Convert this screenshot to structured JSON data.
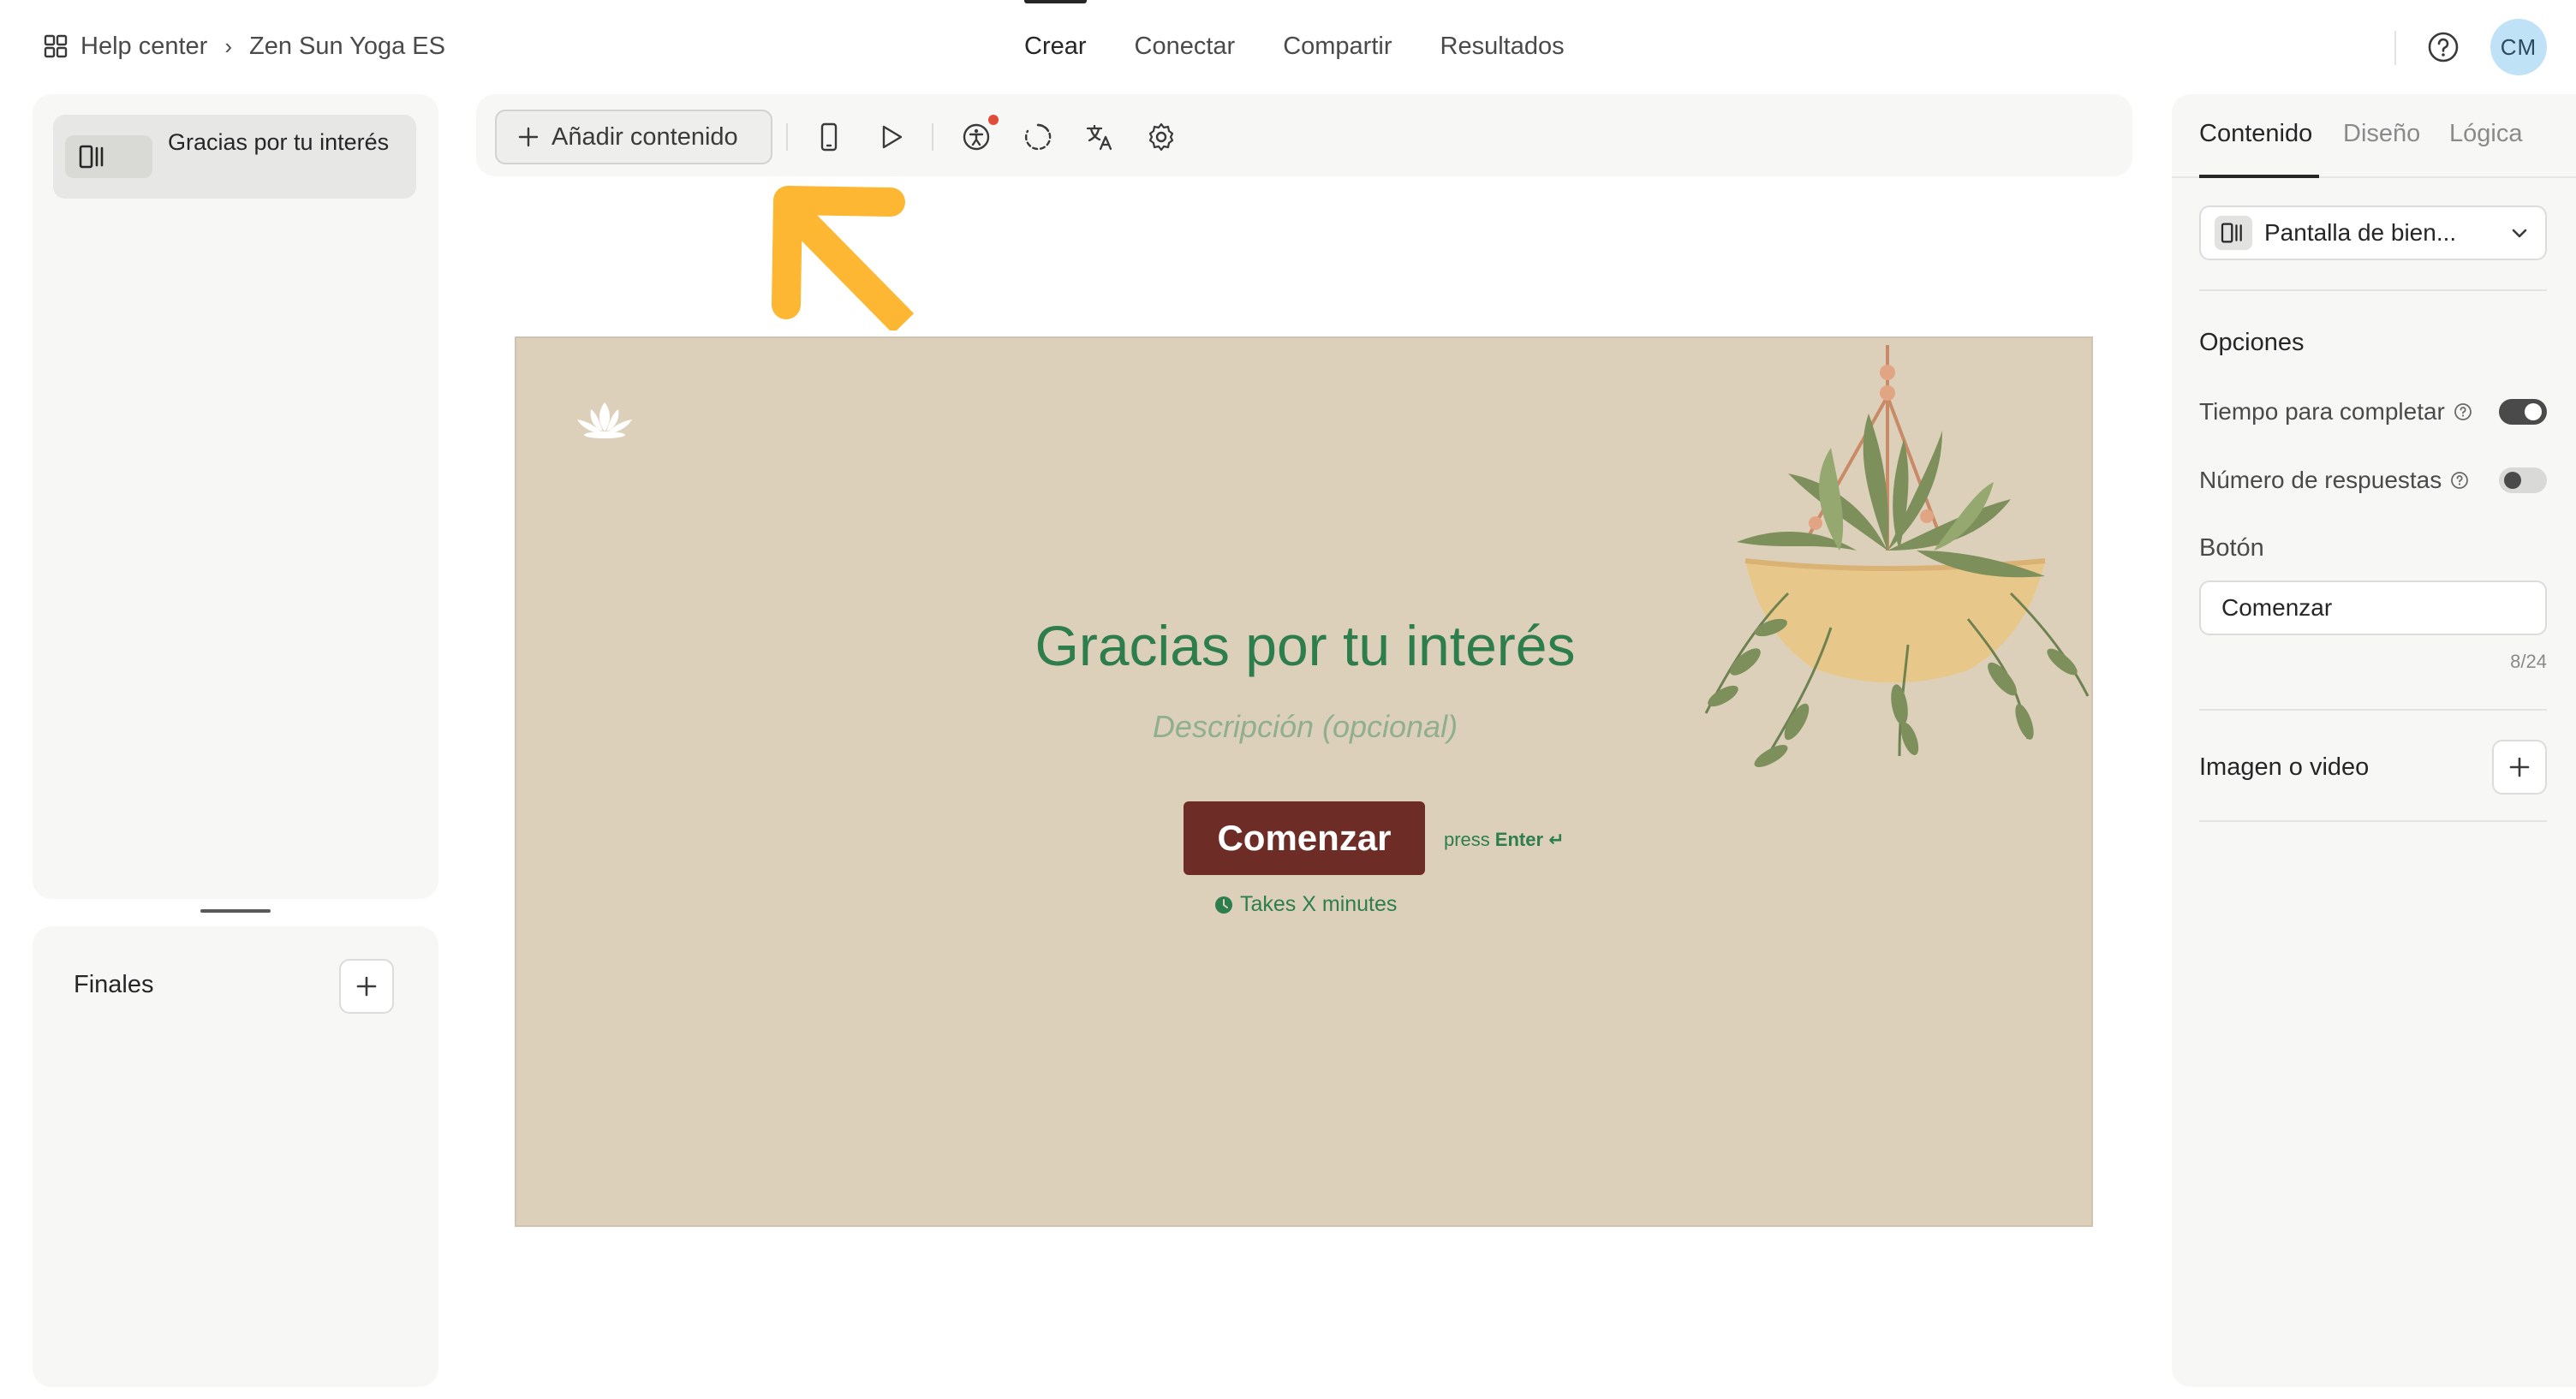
{
  "breadcrumb": {
    "root": "Help center",
    "current": "Zen Sun Yoga ES"
  },
  "nav": {
    "tabs": [
      "Crear",
      "Conectar",
      "Compartir",
      "Resultados"
    ],
    "active": 0
  },
  "user": {
    "initials": "CM"
  },
  "questions": {
    "items": [
      {
        "label": "Gracias por tu interés"
      }
    ]
  },
  "endings": {
    "label": "Finales"
  },
  "toolbar": {
    "add_label": "Añadir contenido"
  },
  "screen": {
    "title": "Gracias por tu interés",
    "description": "Descripción (opcional)",
    "button": "Comenzar",
    "press": "press",
    "press_key": "Enter ↵",
    "time": "Takes X minutes"
  },
  "panel": {
    "tabs": [
      "Contenido",
      "Diseño",
      "Lógica"
    ],
    "active_tab": 0,
    "screen_type": "Pantalla de bien...",
    "options_title": "Opciones",
    "time_to_complete": {
      "label": "Tiempo para completar",
      "on": true
    },
    "num_responses": {
      "label": "Número de respuestas",
      "on": false
    },
    "button_label": "Botón",
    "button_value": "Comenzar",
    "char_count": "8/24",
    "media_label": "Imagen o video"
  },
  "colors": {
    "title_green": "#2e7d4c",
    "button_red": "#6d2c25",
    "canvas_bg": "#ddd0bb",
    "arrow": "#fdb733"
  }
}
